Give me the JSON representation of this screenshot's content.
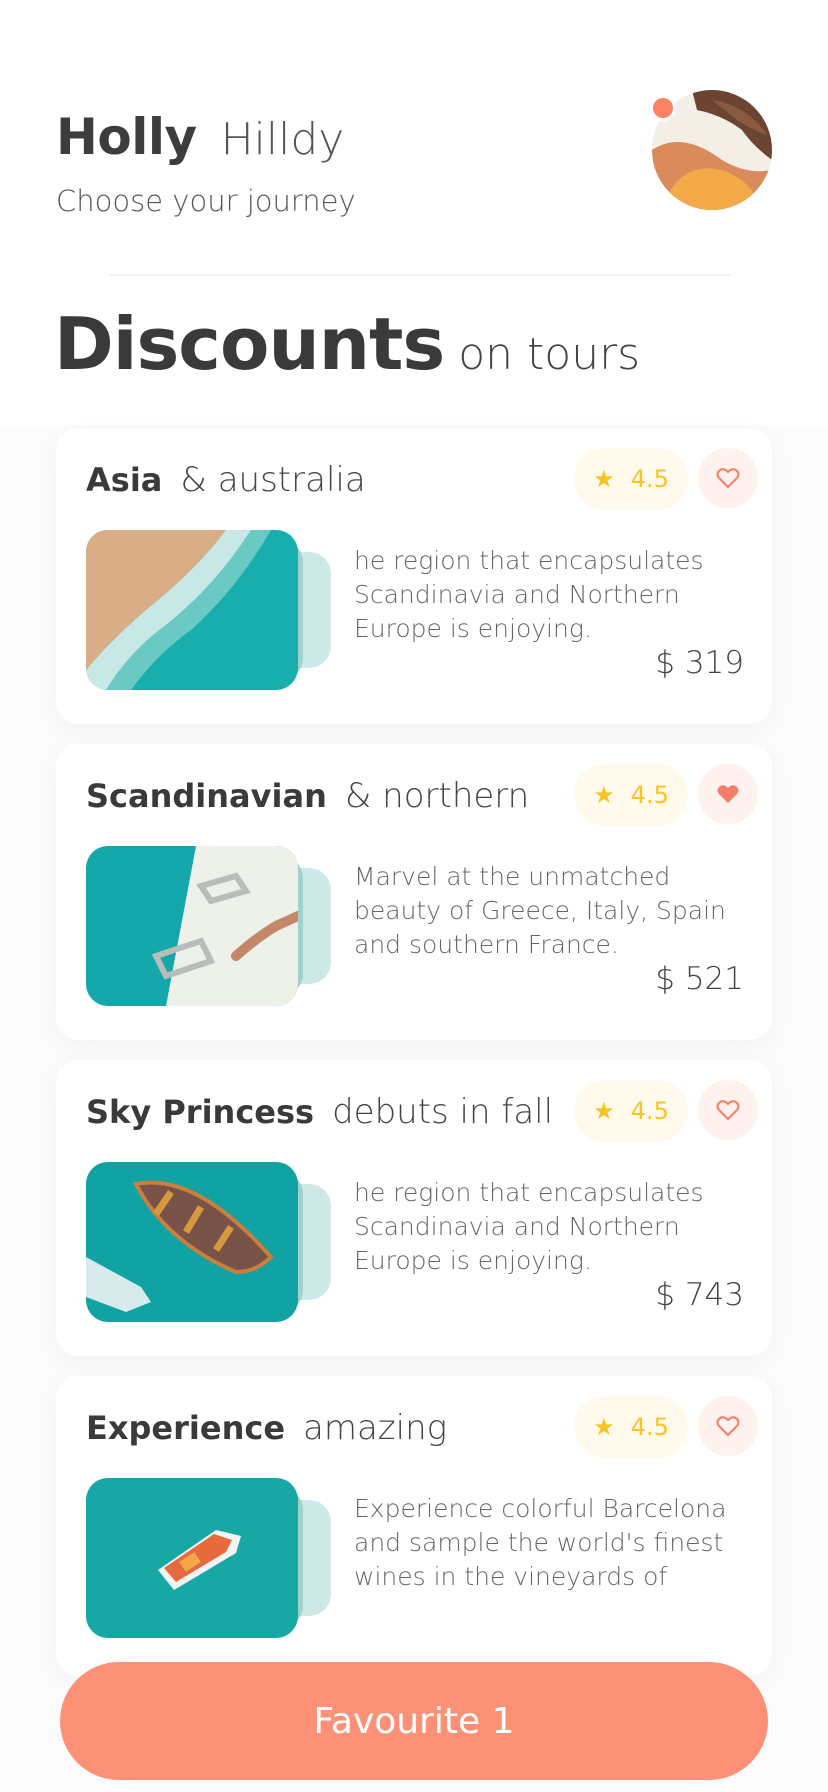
{
  "user": {
    "first_name": "Holly",
    "last_name": "Hilldy",
    "subtitle": "Choose  your journey"
  },
  "section": {
    "title_bold": "Discounts",
    "title_light": "on tours"
  },
  "tours": [
    {
      "title_bold": "Asia",
      "title_light": "& australia",
      "rating": "4.5",
      "favorited": false,
      "description": "he region that encapsulates Scandinavia and Northern Europe is enjoying.",
      "price": "$ 319",
      "image": "beach-waves-photo"
    },
    {
      "title_bold": "Scandinavian",
      "title_light": "& northern",
      "rating": "4.5",
      "favorited": true,
      "description": "Marvel at the unmatched beauty of Greece, Italy, Spain and southern France.",
      "price": "$ 521",
      "image": "boat-deck-photo"
    },
    {
      "title_bold": "Sky Princess",
      "title_light": "debuts in fall",
      "rating": "4.5",
      "favorited": false,
      "description": "he region that encapsulates Scandinavia and Northern Europe is enjoying.",
      "price": "$ 743",
      "image": "rowboat-photo"
    },
    {
      "title_bold": "Experience",
      "title_light": "amazing",
      "rating": "4.5",
      "favorited": false,
      "description": "Experience colorful Barcelona and sample the world's finest wines in the vineyards of",
      "price": "",
      "image": "speedboat-photo"
    }
  ],
  "favourite_button": "Favourite 1",
  "colors": {
    "accent": "#fc9178",
    "star": "#f6c426",
    "heart": "#f47e6a",
    "sea": "#16aeae"
  }
}
